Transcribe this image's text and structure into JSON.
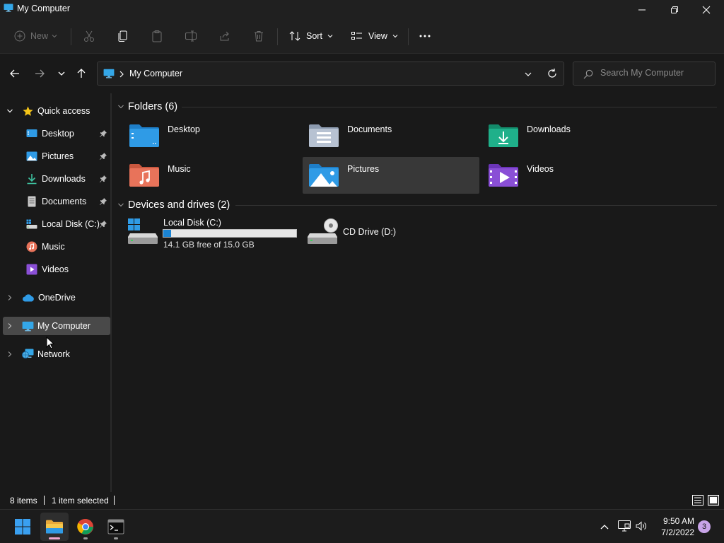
{
  "window": {
    "title": "My Computer"
  },
  "toolbar": {
    "new_label": "New",
    "sort_label": "Sort",
    "view_label": "View"
  },
  "address": {
    "path": "My Computer"
  },
  "search": {
    "placeholder": "Search My Computer"
  },
  "sidebar": {
    "quick_access": "Quick access",
    "quick_items": [
      {
        "label": "Desktop",
        "icon": "desktop-icon",
        "pinned": true
      },
      {
        "label": "Pictures",
        "icon": "pictures-icon",
        "pinned": true
      },
      {
        "label": "Downloads",
        "icon": "downloads-icon",
        "pinned": true
      },
      {
        "label": "Documents",
        "icon": "documents-icon",
        "pinned": true
      },
      {
        "label": "Local Disk (C:)",
        "icon": "local-disk-icon",
        "pinned": true
      },
      {
        "label": "Music",
        "icon": "music-icon",
        "pinned": false
      },
      {
        "label": "Videos",
        "icon": "videos-icon",
        "pinned": false
      }
    ],
    "onedrive": "OneDrive",
    "my_computer": "My Computer",
    "network": "Network"
  },
  "content": {
    "folders_header": "Folders (6)",
    "folders": [
      {
        "label": "Desktop",
        "icon": "desktop-folder-icon"
      },
      {
        "label": "Documents",
        "icon": "documents-folder-icon"
      },
      {
        "label": "Downloads",
        "icon": "downloads-folder-icon"
      },
      {
        "label": "Music",
        "icon": "music-folder-icon"
      },
      {
        "label": "Pictures",
        "icon": "pictures-folder-icon",
        "selected": true
      },
      {
        "label": "Videos",
        "icon": "videos-folder-icon"
      }
    ],
    "drives_header": "Devices and drives (2)",
    "drives": [
      {
        "label": "Local Disk (C:)",
        "free_text": "14.1 GB free of 15.0 GB",
        "used_fraction": 0.06,
        "icon": "hard-drive-icon"
      },
      {
        "label": "CD Drive (D:)",
        "icon": "cd-drive-icon"
      }
    ]
  },
  "status": {
    "items": "8 items",
    "selected": "1 item selected"
  },
  "taskbar": {
    "time": "9:50 AM",
    "date": "7/2/2022",
    "notifications": "3"
  },
  "colors": {
    "accent": "#1b84d4",
    "folder_blue": "#2f9be6",
    "downloads_green": "#1fb08a",
    "music_orange": "#e8735a",
    "videos_purple": "#8a4fd6"
  }
}
